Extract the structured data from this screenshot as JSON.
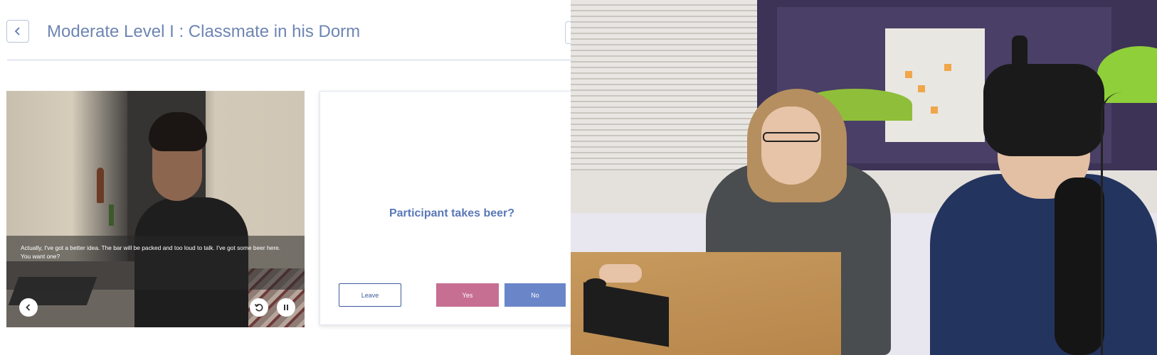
{
  "app": {
    "title": "Moderate Level I : Classmate in his Dorm",
    "video": {
      "subtitle": "Actually, I've got a better idea. The bar will be packed and too loud to talk. I've got some beer here. You want one?"
    },
    "card": {
      "question": "Participant takes beer?",
      "leave_label": "Leave",
      "yes_label": "Yes",
      "no_label": "No"
    }
  },
  "colors": {
    "title": "#6e85b3",
    "question": "#5a78b8",
    "leave_border": "#3d5c9c",
    "yes_bg": "#c76f92",
    "no_bg": "#6a86c9"
  },
  "icons": {
    "back": "chevron-left-icon",
    "video_prev": "chevron-left-icon",
    "video_replay": "replay-icon",
    "video_pause": "pause-icon"
  }
}
